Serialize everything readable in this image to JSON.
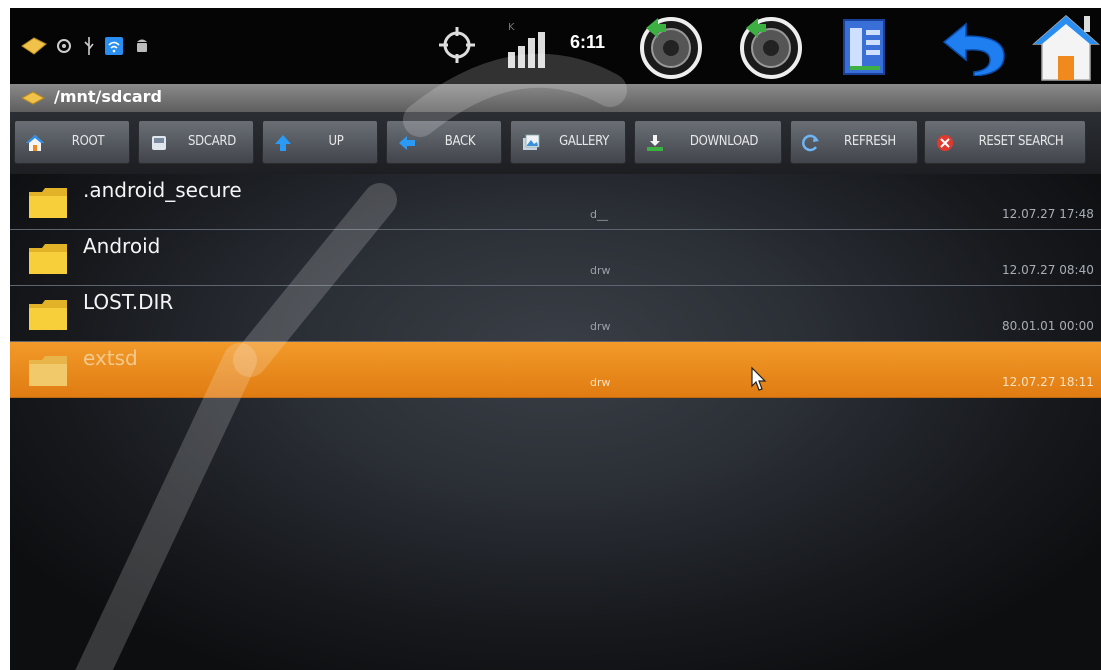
{
  "statusbar": {
    "time": "6:11",
    "icons": [
      "puzzle-icon",
      "settings-icon",
      "usb-icon",
      "wifi-icon",
      "android-icon",
      "gps-icon",
      "signal-icon",
      "volume-down-icon",
      "volume-up-icon",
      "menu-icon",
      "back-icon",
      "home-icon"
    ]
  },
  "pathbar": {
    "path": "/mnt/sdcard"
  },
  "toolbar": {
    "buttons": [
      {
        "label": "ROOT",
        "icon": "home-icon"
      },
      {
        "label": "SDCARD",
        "icon": "sdcard-icon"
      },
      {
        "label": "UP",
        "icon": "up-arrow-icon"
      },
      {
        "label": "BACK",
        "icon": "back-arrow-icon"
      },
      {
        "label": "GALLERY",
        "icon": "gallery-icon"
      },
      {
        "label": "DOWNLOAD",
        "icon": "download-icon"
      },
      {
        "label": "REFRESH",
        "icon": "refresh-icon"
      },
      {
        "label": "RESET SEARCH",
        "icon": "reset-search-icon"
      }
    ]
  },
  "files": [
    {
      "name": ".android_secure",
      "perm": "d__",
      "date": "12.07.27 17:48",
      "selected": false
    },
    {
      "name": "Android",
      "perm": "drw",
      "date": "12.07.27 08:40",
      "selected": false
    },
    {
      "name": "LOST.DIR",
      "perm": "drw",
      "date": "80.01.01 00:00",
      "selected": false
    },
    {
      "name": "extsd",
      "perm": "drw",
      "date": "12.07.27 18:11",
      "selected": true
    }
  ],
  "colors": {
    "selected_row": "#e8861a",
    "background": "#1c1f24",
    "accent_blue": "#2a8ef0",
    "home_orange": "#f08a1e"
  }
}
